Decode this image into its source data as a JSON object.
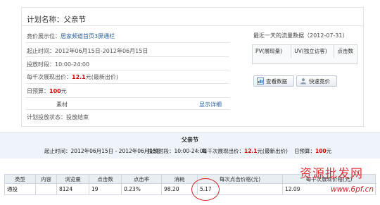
{
  "plan": {
    "name_label": "计划名称：",
    "name_value": "父亲节",
    "position_label": "竟价展示位：",
    "position_value": "居家频道首页3屏通栏",
    "start_label": "起止时间：",
    "start_value": "2012年06月15日-2012年06月15日",
    "hours_label": "投放时段：",
    "hours_value": "10:00-24:00",
    "bid_label": "每千次展现出价：",
    "bid_value": "12.1",
    "bid_suffix": "元(最新出价)",
    "budget_label": "日预算：",
    "budget_value": "100",
    "budget_suffix": "元",
    "material_label": "素材",
    "material_link": "显示详细",
    "status_label": "计划投放状态：",
    "status_value": "投放结束"
  },
  "right_panel": {
    "title": "最近一天的流量数据（2012-07-31）",
    "headers": [
      "PV(展现量)",
      "UV(独立访客)",
      "点击数"
    ],
    "btn_view": "查看数据",
    "btn_bid": "快速竟价"
  },
  "report": {
    "title": "父亲节",
    "time_label": "起止时间：",
    "time_value": "2012年06月15日 - 2012年06月15日",
    "hours_label": "投放时段：",
    "hours_value": "10:00-24:00",
    "bid_label": "每千次展现出价：",
    "bid_value": "12.1",
    "bid_suffix": "元(最新出价)",
    "budget_label": "日预算：",
    "budget_value": "100",
    "budget_suffix": "元",
    "columns": [
      "类型",
      "内容",
      "浏览量",
      "点击数",
      "点击率",
      "消耗",
      "每次点击价格(元)",
      "每千次展现价格(元)"
    ],
    "row": [
      "通投",
      "",
      "8124",
      "19",
      "0.23%",
      "98.20",
      "5.17",
      "12.09"
    ]
  },
  "watermark": {
    "text_cn": "资源批发网",
    "text_url": "www.6pf.cn"
  },
  "colors": {
    "link": "#2a5d9f",
    "highlight_red": "#d40000",
    "circle": "#d2222a"
  }
}
